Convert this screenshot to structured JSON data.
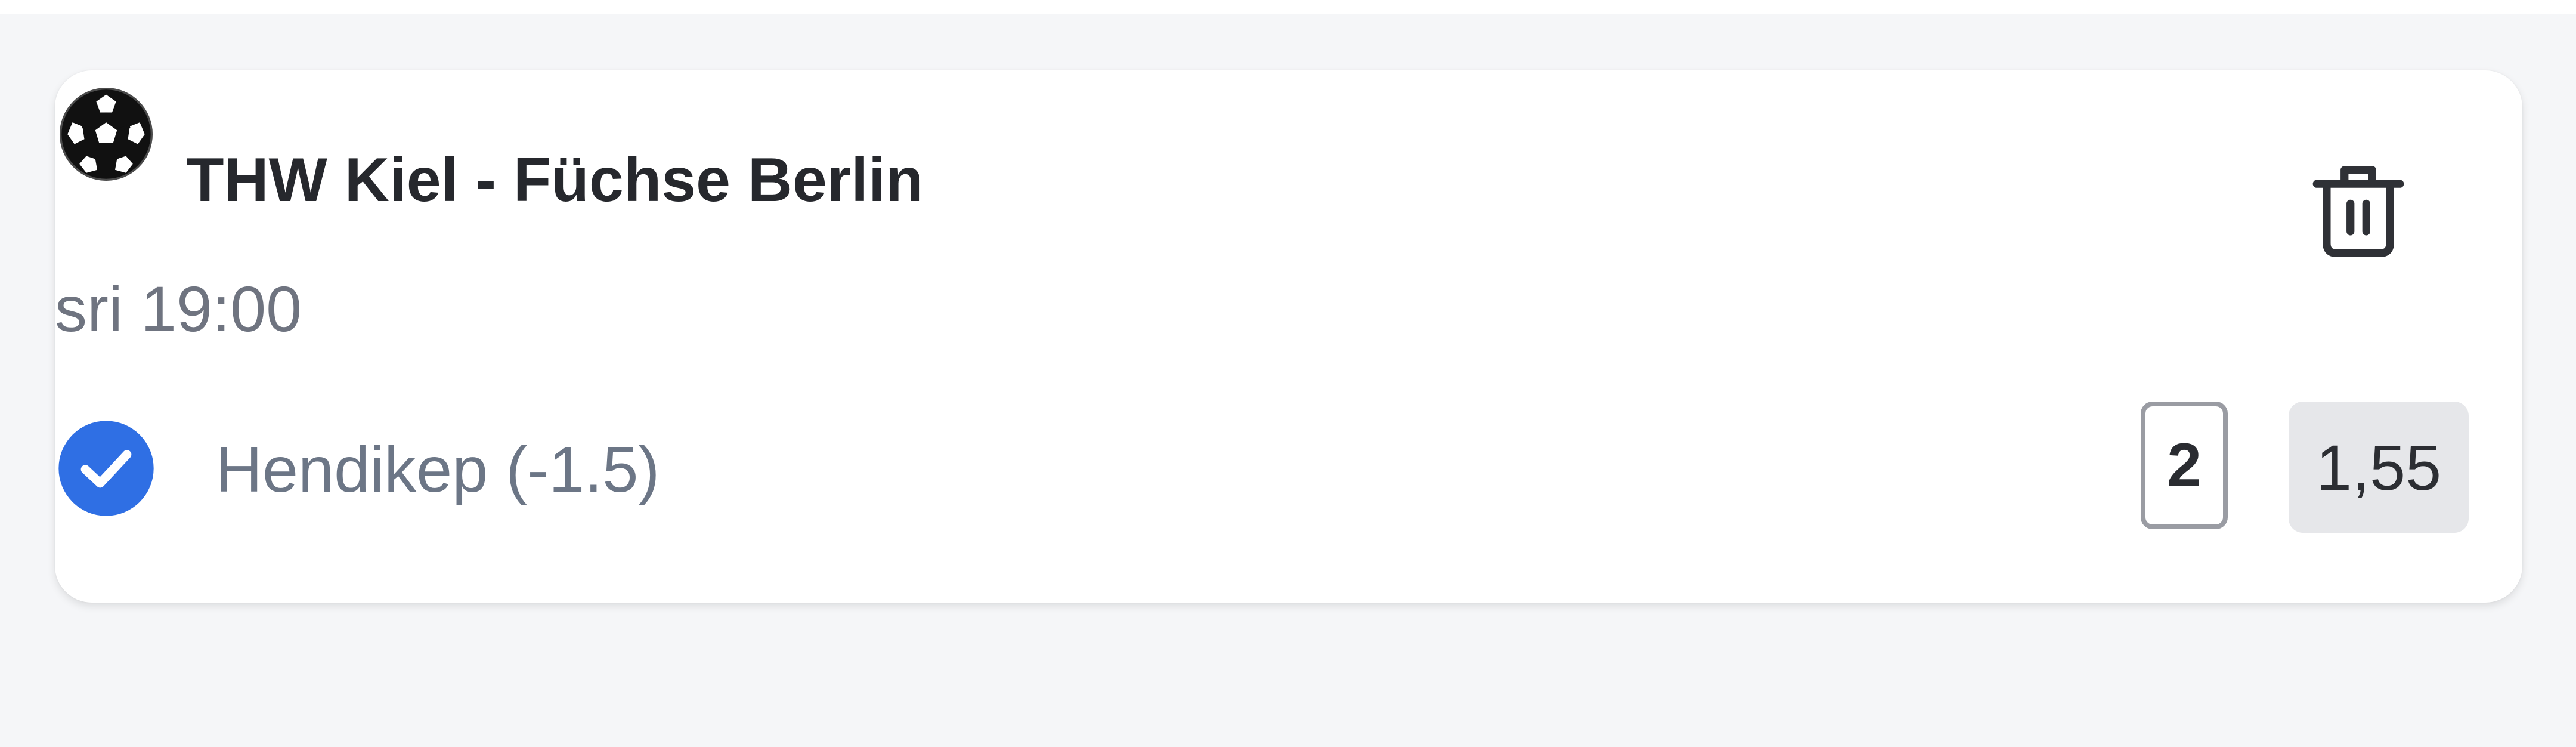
{
  "colors": {
    "page_background": "#f5f6f8",
    "card_background": "#ffffff",
    "title_text": "#26282d",
    "muted_text": "#6f7480",
    "check_accent": "#2f6fe4",
    "odds_background": "#e6e7ea"
  },
  "bet_slip": {
    "item": {
      "sport_icon": "handball-icon",
      "match_title": "THW Kiel - Füchse Berlin",
      "match_time": "sri 19:00",
      "delete_icon": "trash-icon",
      "selected": true,
      "check_icon": "check-circle-icon",
      "market_label": "Hendikep (-1.5)",
      "outcome": "2",
      "odds": "1,55"
    }
  }
}
